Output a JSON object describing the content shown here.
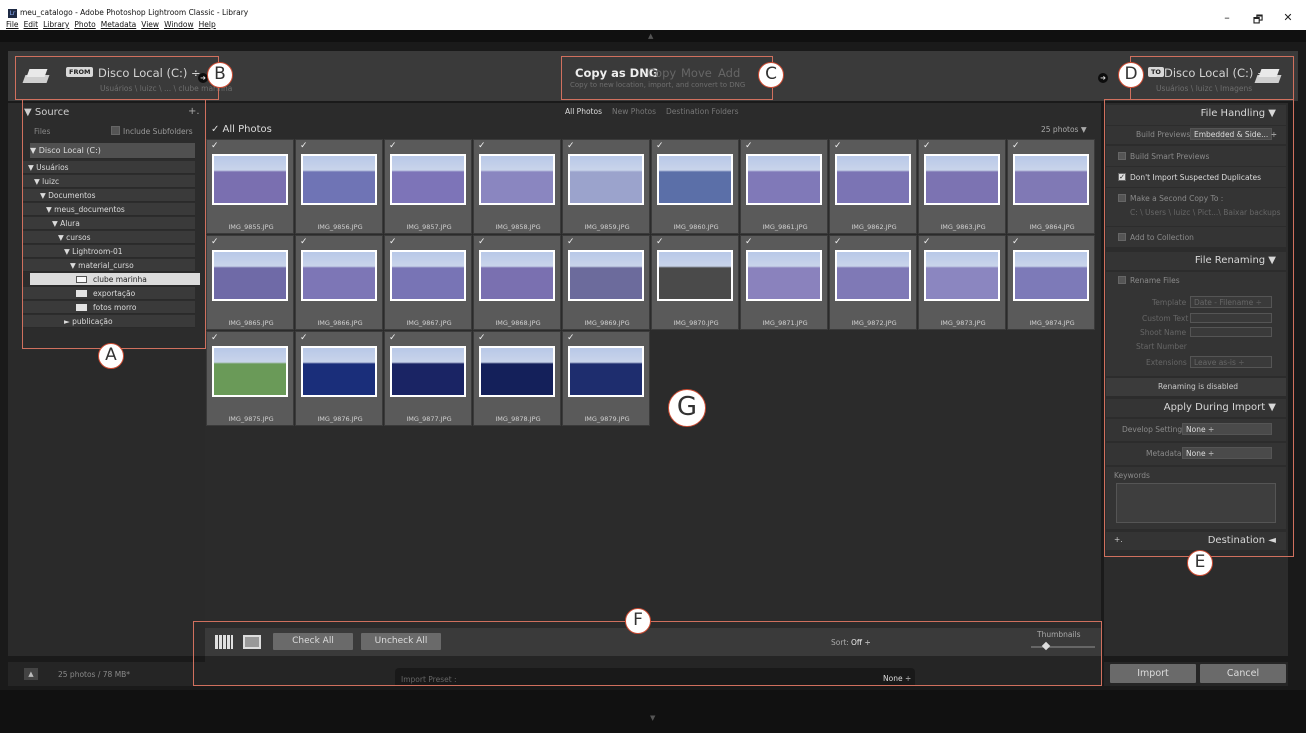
{
  "window": {
    "title": "meu_catalogo - Adobe Photoshop Lightroom Classic - Library",
    "app_icon": "Lr",
    "controls": [
      "–",
      "🗗",
      "✕"
    ],
    "menu": [
      "File",
      "Edit",
      "Library",
      "Photo",
      "Metadata",
      "View",
      "Window",
      "Help"
    ]
  },
  "header": {
    "from_tag": "FROM",
    "from_title": "Disco Local (C:) ÷",
    "from_path": "Usuários \\ luizc \\ ... \\ clube marinha",
    "modes": [
      "Copy as DNG",
      "Copy",
      "Move",
      "Add"
    ],
    "mode_sub": "Copy to new location, import, and convert to DNG",
    "to_tag": "TO",
    "to_title": "Disco Local (C:) ÷",
    "to_path": "Usuários \\ luizc \\ Imagens"
  },
  "callouts": {
    "a": "A",
    "b": "B",
    "c": "C",
    "d": "D",
    "e": "E",
    "f": "F",
    "g": "G"
  },
  "source": {
    "title": "▼ Source",
    "plus": "+.",
    "files_label": "Files",
    "include_subfolders": "Include Subfolders",
    "tree": [
      {
        "label": "▼ Disco Local (C:)"
      },
      {
        "label": "▼ Usuários"
      },
      {
        "label": "▼ luizc"
      },
      {
        "label": "▼ Documentos"
      },
      {
        "label": "▼ meus_documentos"
      },
      {
        "label": "▼ Alura"
      },
      {
        "label": "▼ cursos"
      },
      {
        "label": "▼ Lightroom-01"
      },
      {
        "label": "▼ material_curso"
      },
      {
        "label": "clube marinha"
      },
      {
        "label": "exportação"
      },
      {
        "label": "fotos morro"
      },
      {
        "label": "► publicação"
      }
    ],
    "summary": "25 photos / 78 MB*"
  },
  "grid": {
    "tabs": [
      "All Photos",
      "New Photos",
      "Destination Folders"
    ],
    "all_photos": "✓ All Photos",
    "count": "25 photos ▼",
    "photos": [
      {
        "name": "IMG_9855.JPG",
        "checked": true
      },
      {
        "name": "IMG_9856.JPG",
        "checked": true
      },
      {
        "name": "IMG_9857.JPG",
        "checked": true
      },
      {
        "name": "IMG_9858.JPG",
        "checked": true
      },
      {
        "name": "IMG_9859.JPG",
        "checked": true
      },
      {
        "name": "IMG_9860.JPG",
        "checked": true
      },
      {
        "name": "IMG_9861.JPG",
        "checked": true
      },
      {
        "name": "IMG_9862.JPG",
        "checked": true
      },
      {
        "name": "IMG_9863.JPG",
        "checked": true
      },
      {
        "name": "IMG_9864.JPG",
        "checked": true
      },
      {
        "name": "IMG_9865.JPG",
        "checked": true
      },
      {
        "name": "IMG_9866.JPG",
        "checked": true
      },
      {
        "name": "IMG_9867.JPG",
        "checked": true
      },
      {
        "name": "IMG_9868.JPG",
        "checked": true
      },
      {
        "name": "IMG_9869.JPG",
        "checked": true
      },
      {
        "name": "IMG_9870.JPG",
        "checked": true
      },
      {
        "name": "IMG_9871.JPG",
        "checked": true
      },
      {
        "name": "IMG_9872.JPG",
        "checked": true
      },
      {
        "name": "IMG_9873.JPG",
        "checked": true
      },
      {
        "name": "IMG_9874.JPG",
        "checked": true
      },
      {
        "name": "IMG_9875.JPG",
        "checked": true
      },
      {
        "name": "IMG_9876.JPG",
        "checked": true
      },
      {
        "name": "IMG_9877.JPG",
        "checked": true
      },
      {
        "name": "IMG_9878.JPG",
        "checked": true
      },
      {
        "name": "IMG_9879.JPG",
        "checked": true
      }
    ],
    "thumb_colors": [
      "#7a6fb0",
      "#6f74b5",
      "#7d74b8",
      "#8a86c0",
      "#9ba3cc",
      "#5b6fa8",
      "#8079b8",
      "#7b74b4",
      "#7c73b2",
      "#8079b5",
      "#6f6aa7",
      "#7d76b6",
      "#7874b5",
      "#7a70b0",
      "#6c6b9c",
      "#4a4a4a",
      "#8a82bd",
      "#7f79b6",
      "#8b86c0",
      "#7d7ab8",
      "#6a9a58",
      "#1a2e7a",
      "#1a2464",
      "#14205a",
      "#1e2d6e"
    ],
    "check_all": "Check All",
    "uncheck_all": "Uncheck All",
    "sort_label": "Sort:",
    "sort_value": "Off ÷",
    "thumbnails_label": "Thumbnails",
    "import_preset_label": "Import Preset :",
    "import_preset_value": "None ÷"
  },
  "right": {
    "file_handling": "File Handling ▼",
    "build_previews_label": "Build Previews",
    "build_previews_value": "Embedded & Side... ÷",
    "build_smart": "Build Smart Previews",
    "dont_import_dup": "Don't Import Suspected Duplicates",
    "second_copy": "Make a Second Copy To :",
    "second_copy_path": "C: \\ Users \\ luizc \\ Pict...\\ Baixar backups",
    "add_collection": "Add to Collection",
    "file_renaming": "File Renaming ▼",
    "rename_files": "Rename Files",
    "template_label": "Template",
    "template_value": "Date - Filename ÷",
    "custom_text": "Custom Text",
    "shoot_name": "Shoot Name",
    "start_number": "Start Number",
    "extensions_label": "Extensions",
    "extensions_value": "Leave as-is ÷",
    "renaming_disabled": "Renaming is disabled",
    "apply_during": "Apply During Import ▼",
    "develop_label": "Develop Settings",
    "develop_value": "None ÷",
    "metadata_label": "Metadata",
    "metadata_value": "None ÷",
    "keywords_label": "Keywords",
    "destination_plus": "+.",
    "destination": "Destination ◄",
    "import_btn": "Import",
    "cancel_btn": "Cancel"
  },
  "colors": {
    "accent_red": "#d0705e",
    "panel_bg": "#2c2c2c",
    "header_bg": "#3a3a3a"
  }
}
